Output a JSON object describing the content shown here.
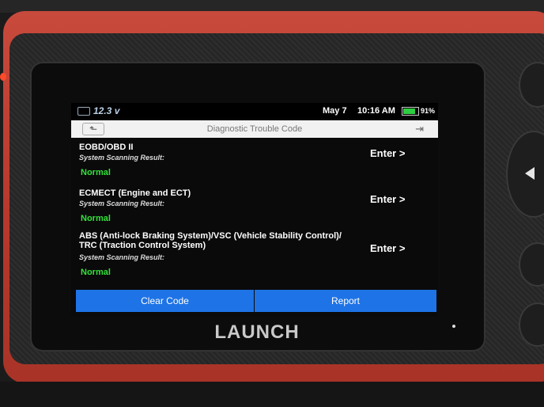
{
  "status_bar": {
    "voltage": "12.3 v",
    "date": "May 7",
    "time": "10:16 AM",
    "battery_percent": "91%"
  },
  "titlebar": {
    "title": "Diagnostic Trouble Code"
  },
  "items": [
    {
      "name": "EOBD/OBD II",
      "result_label": "System Scanning Result:",
      "status": "Normal",
      "action": "Enter >"
    },
    {
      "name": "ECMECT (Engine and ECT)",
      "result_label": "System Scanning Result:",
      "status": "Normal",
      "action": "Enter >"
    },
    {
      "name": "ABS (Anti-lock Braking System)/VSC (Vehicle Stability Control)/ TRC (Traction Control System)",
      "result_label": "System Scanning Result:",
      "status": "Normal",
      "action": "Enter >"
    }
  ],
  "buttons": {
    "clear": "Clear Code",
    "report": "Report"
  },
  "device": {
    "brand": "LAUNCH"
  },
  "colors": {
    "accent_blue": "#1e73e6",
    "status_green": "#33e23a",
    "device_red": "#b8382c"
  }
}
